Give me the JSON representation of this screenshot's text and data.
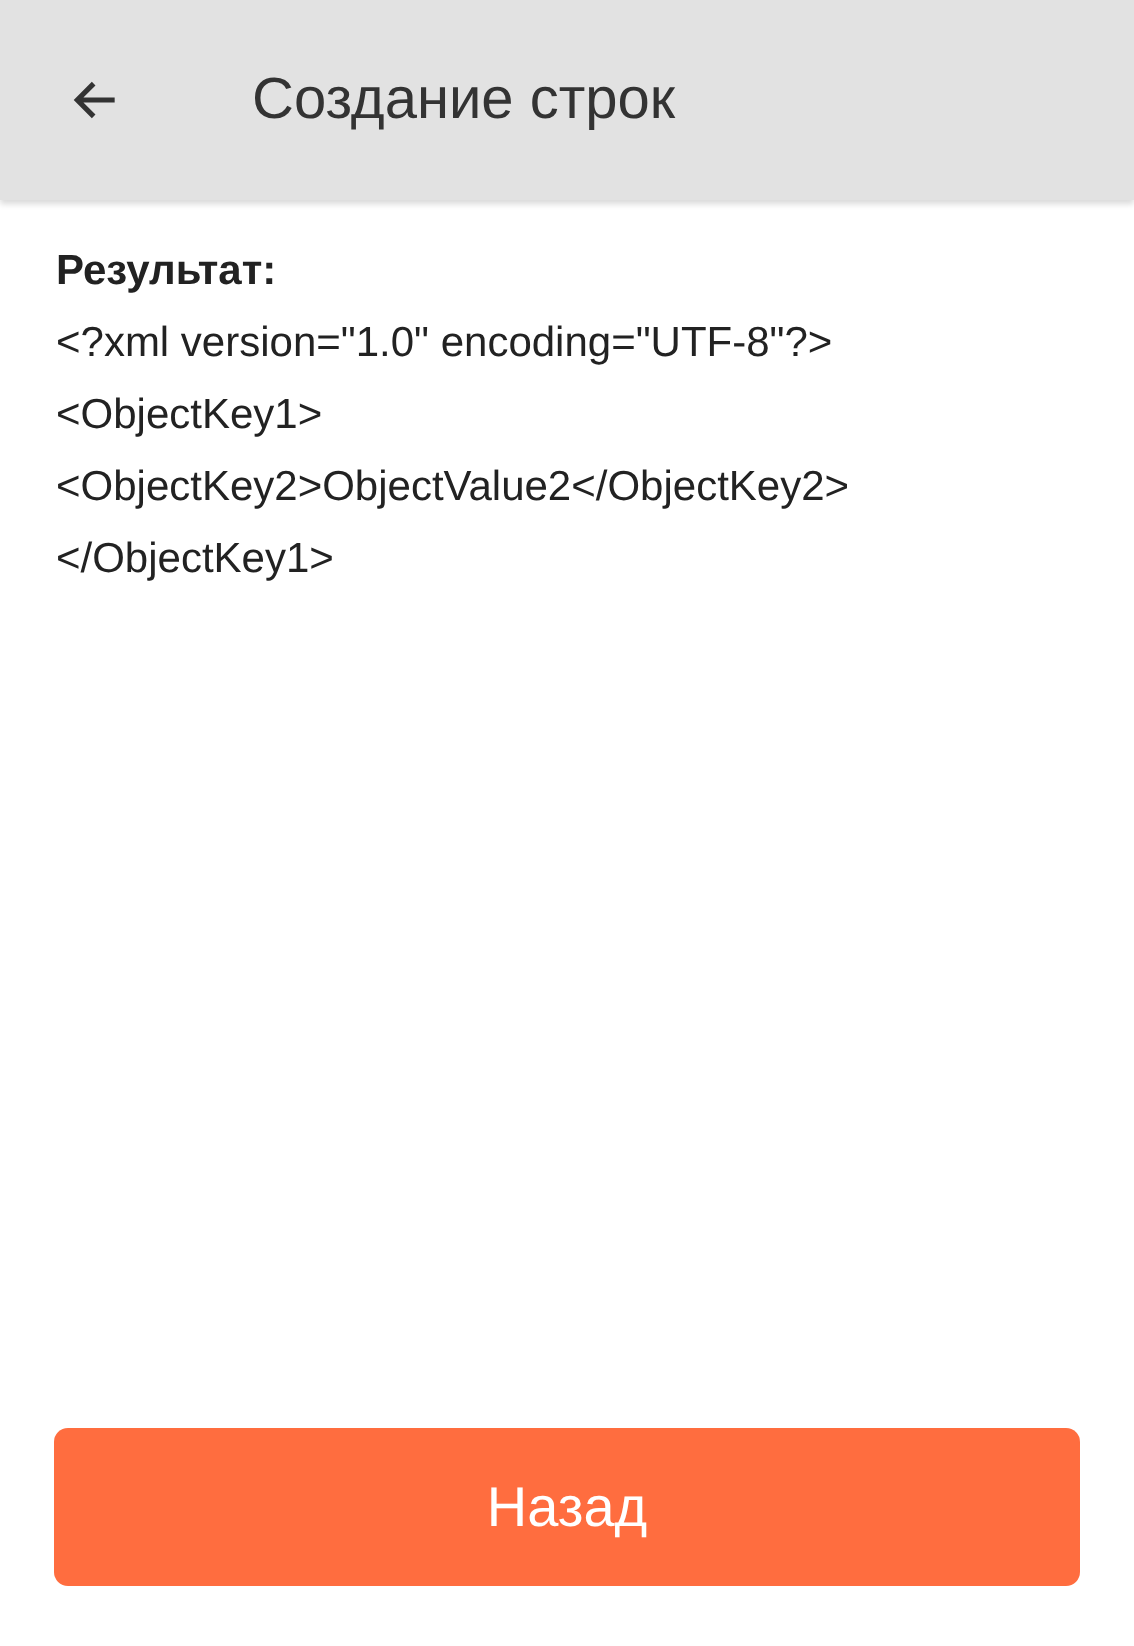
{
  "app_bar": {
    "title": "Создание строк"
  },
  "result": {
    "label": "Результат:",
    "value": "<?xml version=\"1.0\" encoding=\"UTF-8\"?><ObjectKey1><ObjectKey2>ObjectValue2</ObjectKey2></ObjectKey1>"
  },
  "buttons": [
    {
      "label": "Назад"
    }
  ]
}
